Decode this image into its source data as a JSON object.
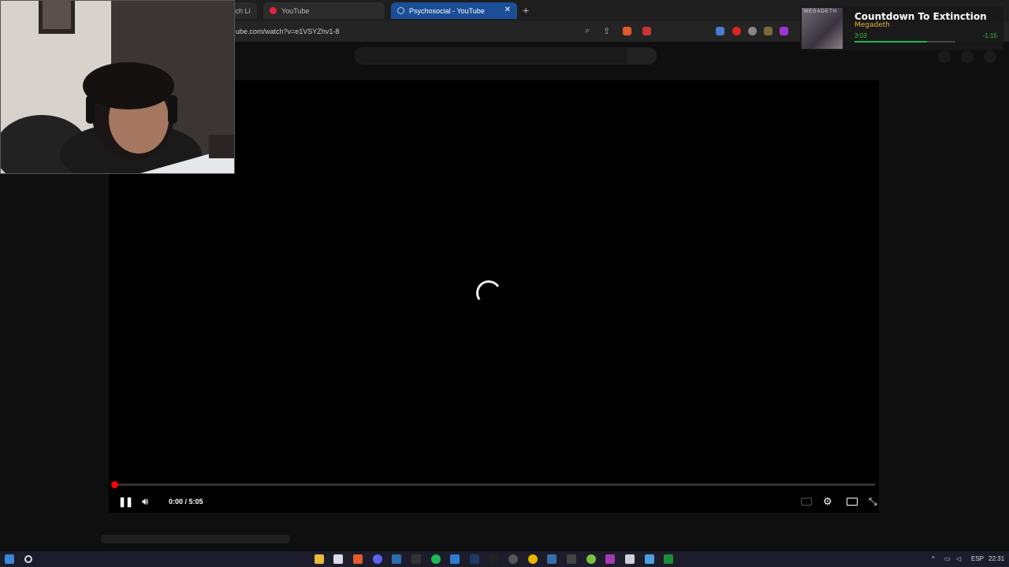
{
  "browser": {
    "tabs": [
      {
        "label": "tch Li"
      },
      {
        "label": "YouTube"
      },
      {
        "label": "Psychosocial - YouTube",
        "active": true
      }
    ],
    "tab_close": "✕",
    "new_tab": "+",
    "url": "ube.com/watch?v=e1VSYZhv1-8"
  },
  "player": {
    "time_display": "0:00 / 5:05",
    "progress_fraction": 0.0,
    "state": "loading"
  },
  "now_playing": {
    "title": "Countdown To Extinction",
    "artist": "Megadeth",
    "elapsed": "3:03",
    "remaining": "-1:15",
    "progress_fraction": 0.72,
    "album_label": "MEGADETH"
  },
  "taskbar": {
    "language": "ESP",
    "clock": "22:31"
  },
  "colors": {
    "accent_red": "#ff0000",
    "active_tab": "#1a4f98",
    "spotify_green": "#1db954",
    "artist_gold": "#e7b53a"
  }
}
